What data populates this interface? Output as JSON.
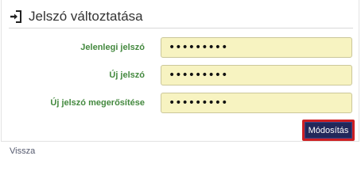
{
  "panel": {
    "title": "Jelszó változtatása",
    "title_icon": "sign-in-icon"
  },
  "form": {
    "fields": [
      {
        "label": "Jelenlegi jelszó",
        "value": "•••••••••"
      },
      {
        "label": "Új jelszó",
        "value": "•••••••••"
      },
      {
        "label": "Új jelszó megerősítése",
        "value": "•••••••••"
      }
    ],
    "submit_label": "Módosítás"
  },
  "footer": {
    "back_label": "Vissza"
  },
  "colors": {
    "label_green": "#44893f",
    "field_bg": "#f7f3c1",
    "button_bg": "#22285a",
    "button_focus_border": "#cc1f23"
  }
}
